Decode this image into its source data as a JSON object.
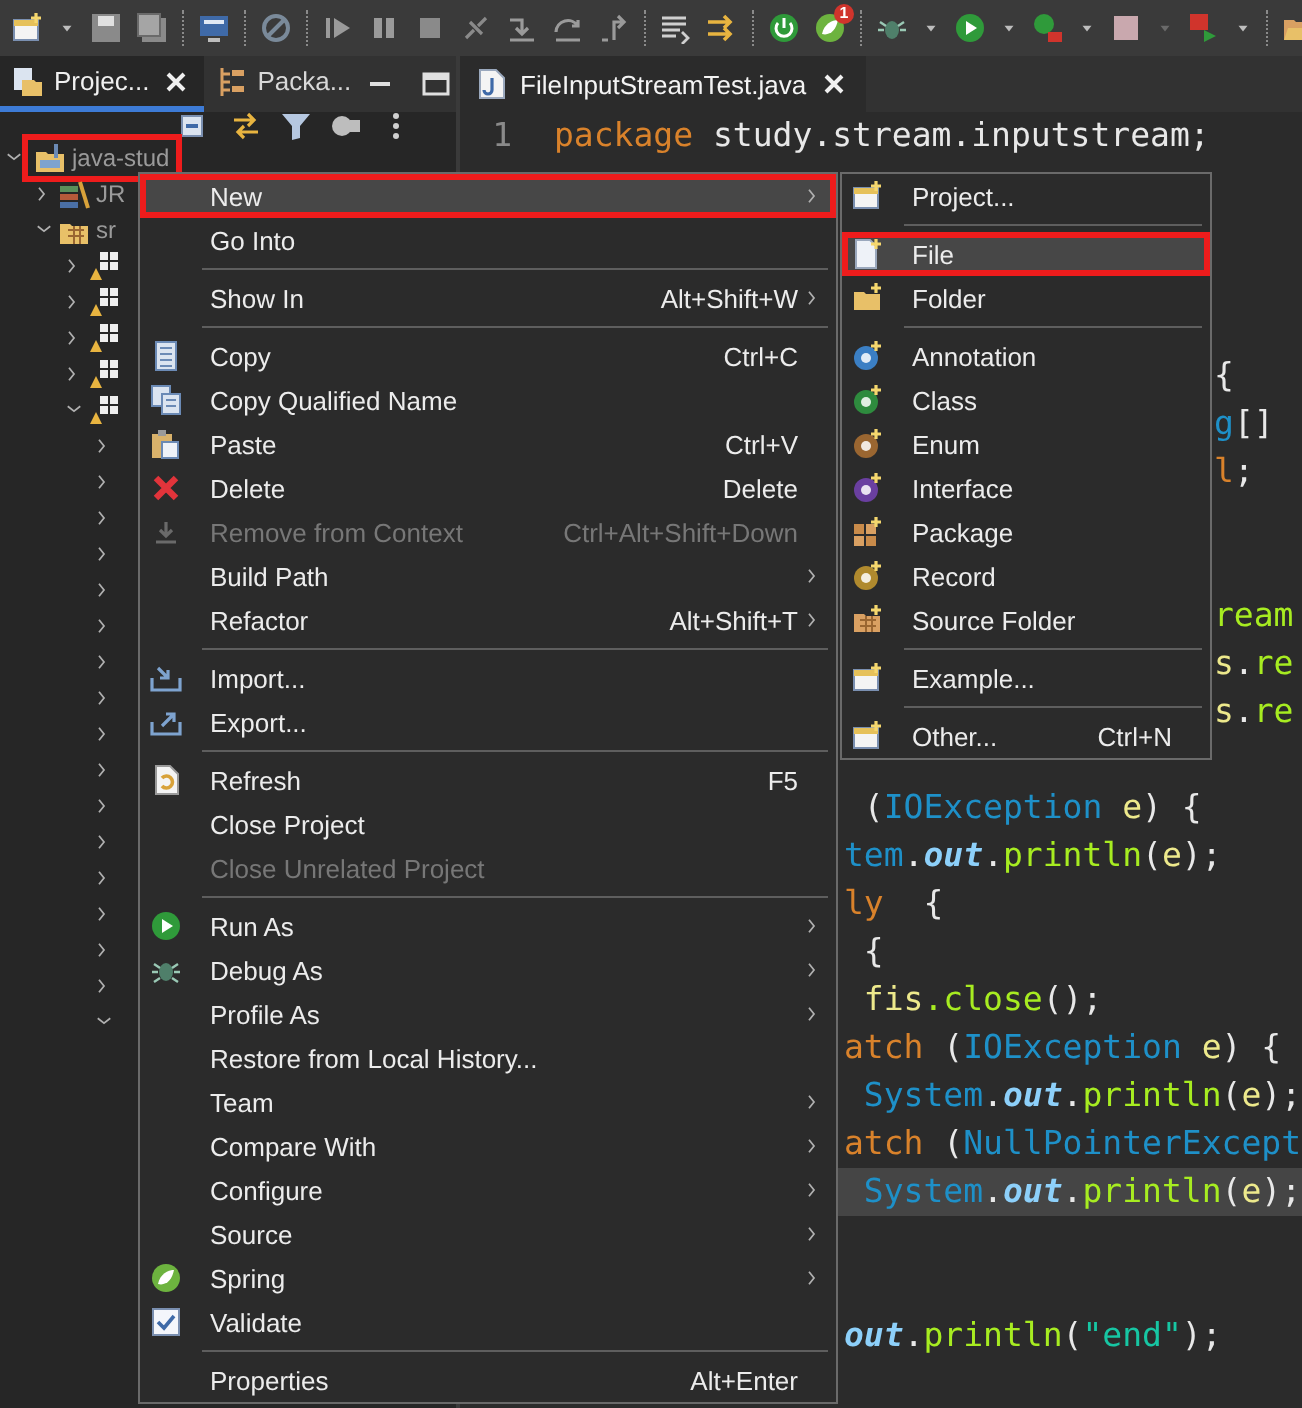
{
  "toolbar": {
    "badge": "1"
  },
  "left_panel": {
    "tabs": [
      {
        "label": "Projec...",
        "selected": true
      },
      {
        "label": "Packa...",
        "selected": false
      }
    ]
  },
  "tree": [
    {
      "label": "java-stud",
      "kind": "project",
      "expanded": true,
      "annotated": true,
      "children": [
        {
          "label": "JR",
          "kind": "library",
          "expanded": false,
          "annotated": false
        },
        {
          "label": "sr",
          "kind": "source-folder",
          "expanded": true,
          "annotated": false,
          "children": [
            {
              "kind": "package",
              "expanded": false,
              "annotated": false
            },
            {
              "kind": "package",
              "expanded": false,
              "annotated": false
            },
            {
              "kind": "package",
              "expanded": false,
              "annotated": false
            },
            {
              "kind": "package",
              "expanded": false,
              "annotated": false
            },
            {
              "kind": "package",
              "expanded": true,
              "annotated": false,
              "children": [
                {
                  "expanded": false
                },
                {
                  "expanded": false
                },
                {
                  "expanded": false
                },
                {
                  "expanded": false
                },
                {
                  "expanded": false
                },
                {
                  "expanded": false
                },
                {
                  "expanded": false
                },
                {
                  "expanded": false
                },
                {
                  "expanded": false
                },
                {
                  "expanded": false
                },
                {
                  "expanded": false
                },
                {
                  "expanded": false
                },
                {
                  "expanded": false
                },
                {
                  "expanded": false
                },
                {
                  "expanded": false
                },
                {
                  "expanded": false
                },
                {
                  "expanded": true
                }
              ]
            }
          ]
        }
      ]
    }
  ],
  "editor": {
    "tab": {
      "label": "FileInputStreamTest.java",
      "selected": true
    },
    "lines": [
      {
        "number": "1",
        "current": false,
        "tokens": [
          {
            "kind": "keyword",
            "text": "package"
          },
          {
            "kind": "plain",
            "text": " study.stream.inputstream;"
          }
        ]
      },
      {
        "current": false
      },
      {
        "current": false
      },
      {
        "current": false
      },
      {
        "current": false
      },
      {
        "current": false,
        "tokens": [
          {
            "kind": "plain",
            "text": "{"
          }
        ]
      },
      {
        "current": false,
        "tokens": [
          {
            "kind": "type",
            "text": "g"
          },
          {
            "kind": "plain",
            "text": "[]"
          }
        ]
      },
      {
        "current": false,
        "tokens": [
          {
            "kind": "keyword",
            "text": "l"
          },
          {
            "kind": "plain",
            "text": ";"
          }
        ]
      },
      {
        "current": false
      },
      {
        "current": false
      },
      {
        "current": false,
        "tokens": [
          {
            "kind": "method",
            "text": "ream"
          }
        ]
      },
      {
        "current": false,
        "tokens": [
          {
            "kind": "local",
            "text": "s"
          },
          {
            "kind": "plain",
            "text": "."
          },
          {
            "kind": "method",
            "text": "re"
          }
        ]
      },
      {
        "current": false,
        "tokens": [
          {
            "kind": "local",
            "text": "s"
          },
          {
            "kind": "plain",
            "text": "."
          },
          {
            "kind": "method",
            "text": "re"
          }
        ]
      },
      {
        "current": false
      },
      {
        "current": false,
        "tokens": [
          {
            "kind": "plain",
            "text": " ("
          },
          {
            "kind": "type",
            "text": "IOException "
          },
          {
            "kind": "local",
            "text": "e"
          },
          {
            "kind": "plain",
            "text": ") {"
          }
        ]
      },
      {
        "current": false,
        "tokens": [
          {
            "kind": "type",
            "text": "tem"
          },
          {
            "kind": "plain",
            "text": "."
          },
          {
            "kind": "field",
            "text": "out"
          },
          {
            "kind": "plain",
            "text": "."
          },
          {
            "kind": "method",
            "text": "println"
          },
          {
            "kind": "plain",
            "text": "("
          },
          {
            "kind": "local",
            "text": "e"
          },
          {
            "kind": "plain",
            "text": ");"
          }
        ]
      },
      {
        "current": false,
        "tokens": [
          {
            "kind": "keyword",
            "text": "ly"
          },
          {
            "kind": "plain",
            "text": "  {"
          }
        ]
      },
      {
        "current": false,
        "tokens": [
          {
            "kind": "plain",
            "text": " {"
          }
        ]
      },
      {
        "current": false,
        "tokens": [
          {
            "kind": "local",
            "text": " fis"
          },
          {
            "kind": "method",
            "text": ".close"
          },
          {
            "kind": "plain",
            "text": "();"
          }
        ]
      },
      {
        "current": false,
        "tokens": [
          {
            "kind": "keyword",
            "text": "atch"
          },
          {
            "kind": "plain",
            "text": " ("
          },
          {
            "kind": "type",
            "text": "IOException "
          },
          {
            "kind": "local",
            "text": "e"
          },
          {
            "kind": "plain",
            "text": ") {"
          }
        ]
      },
      {
        "current": false,
        "tokens": [
          {
            "kind": "type",
            "text": " System"
          },
          {
            "kind": "plain",
            "text": "."
          },
          {
            "kind": "field",
            "text": "out"
          },
          {
            "kind": "plain",
            "text": "."
          },
          {
            "kind": "method",
            "text": "println"
          },
          {
            "kind": "plain",
            "text": "("
          },
          {
            "kind": "local",
            "text": "e"
          },
          {
            "kind": "plain",
            "text": ");"
          }
        ]
      },
      {
        "current": false,
        "tokens": [
          {
            "kind": "keyword",
            "text": "atch"
          },
          {
            "kind": "plain",
            "text": " ("
          },
          {
            "kind": "type",
            "text": "NullPointerExcept"
          }
        ]
      },
      {
        "current": true,
        "tokens": [
          {
            "kind": "type",
            "text": " System"
          },
          {
            "kind": "plain",
            "text": "."
          },
          {
            "kind": "field",
            "text": "out"
          },
          {
            "kind": "plain",
            "text": "."
          },
          {
            "kind": "method",
            "text": "println"
          },
          {
            "kind": "plain",
            "text": "("
          },
          {
            "kind": "local",
            "text": "e"
          },
          {
            "kind": "plain",
            "text": ");"
          }
        ]
      },
      {
        "current": false
      },
      {
        "current": false
      },
      {
        "current": false,
        "tokens": [
          {
            "kind": "field",
            "text": "out"
          },
          {
            "kind": "plain",
            "text": "."
          },
          {
            "kind": "method",
            "text": "println"
          },
          {
            "kind": "plain",
            "text": "("
          },
          {
            "kind": "string",
            "text": "\"end\""
          },
          {
            "kind": "plain",
            "text": ");"
          }
        ]
      }
    ]
  },
  "context_menu": [
    {
      "kind": "item",
      "label": "New",
      "submenu": true,
      "selected": true,
      "disabled": false,
      "annotated": true
    },
    {
      "kind": "item",
      "label": "Go Into",
      "submenu": false,
      "selected": false,
      "disabled": false,
      "annotated": false
    },
    {
      "kind": "separator"
    },
    {
      "kind": "item",
      "label": "Show In",
      "shortcut": "Alt+Shift+W",
      "submenu": true,
      "selected": false,
      "disabled": false,
      "annotated": false
    },
    {
      "kind": "separator"
    },
    {
      "kind": "item",
      "label": "Copy",
      "shortcut": "Ctrl+C",
      "submenu": false,
      "selected": false,
      "disabled": false,
      "annotated": false
    },
    {
      "kind": "item",
      "label": "Copy Qualified Name",
      "submenu": false,
      "selected": false,
      "disabled": false,
      "annotated": false
    },
    {
      "kind": "item",
      "label": "Paste",
      "shortcut": "Ctrl+V",
      "submenu": false,
      "selected": false,
      "disabled": false,
      "annotated": false
    },
    {
      "kind": "item",
      "label": "Delete",
      "shortcut": "Delete",
      "submenu": false,
      "selected": false,
      "disabled": false,
      "annotated": false
    },
    {
      "kind": "item",
      "label": "Remove from Context",
      "shortcut": "Ctrl+Alt+Shift+Down",
      "submenu": false,
      "selected": false,
      "disabled": true,
      "annotated": false
    },
    {
      "kind": "item",
      "label": "Build Path",
      "submenu": true,
      "selected": false,
      "disabled": false,
      "annotated": false
    },
    {
      "kind": "item",
      "label": "Refactor",
      "shortcut": "Alt+Shift+T",
      "submenu": true,
      "selected": false,
      "disabled": false,
      "annotated": false
    },
    {
      "kind": "separator"
    },
    {
      "kind": "item",
      "label": "Import...",
      "submenu": false,
      "selected": false,
      "disabled": false,
      "annotated": false
    },
    {
      "kind": "item",
      "label": "Export...",
      "submenu": false,
      "selected": false,
      "disabled": false,
      "annotated": false
    },
    {
      "kind": "separator"
    },
    {
      "kind": "item",
      "label": "Refresh",
      "shortcut": "F5",
      "submenu": false,
      "selected": false,
      "disabled": false,
      "annotated": false
    },
    {
      "kind": "item",
      "label": "Close Project",
      "submenu": false,
      "selected": false,
      "disabled": false,
      "annotated": false
    },
    {
      "kind": "item",
      "label": "Close Unrelated Project",
      "submenu": false,
      "selected": false,
      "disabled": true,
      "annotated": false
    },
    {
      "kind": "separator"
    },
    {
      "kind": "item",
      "label": "Run As",
      "submenu": true,
      "selected": false,
      "disabled": false,
      "annotated": false
    },
    {
      "kind": "item",
      "label": "Debug As",
      "submenu": true,
      "selected": false,
      "disabled": false,
      "annotated": false
    },
    {
      "kind": "item",
      "label": "Profile As",
      "submenu": true,
      "selected": false,
      "disabled": false,
      "annotated": false
    },
    {
      "kind": "item",
      "label": "Restore from Local History...",
      "submenu": false,
      "selected": false,
      "disabled": false,
      "annotated": false
    },
    {
      "kind": "item",
      "label": "Team",
      "submenu": true,
      "selected": false,
      "disabled": false,
      "annotated": false
    },
    {
      "kind": "item",
      "label": "Compare With",
      "submenu": true,
      "selected": false,
      "disabled": false,
      "annotated": false
    },
    {
      "kind": "item",
      "label": "Configure",
      "submenu": true,
      "selected": false,
      "disabled": false,
      "annotated": false
    },
    {
      "kind": "item",
      "label": "Source",
      "submenu": true,
      "selected": false,
      "disabled": false,
      "annotated": false
    },
    {
      "kind": "item",
      "label": "Spring",
      "submenu": true,
      "selected": false,
      "disabled": false,
      "annotated": false
    },
    {
      "kind": "item",
      "label": "Validate",
      "submenu": false,
      "selected": false,
      "disabled": false,
      "annotated": false
    },
    {
      "kind": "separator"
    },
    {
      "kind": "item",
      "label": "Properties",
      "shortcut": "Alt+Enter",
      "submenu": false,
      "selected": false,
      "disabled": false,
      "annotated": false
    }
  ],
  "submenu": [
    {
      "kind": "item",
      "label": "Project...",
      "submenu": false,
      "selected": false,
      "disabled": false,
      "annotated": false
    },
    {
      "kind": "separator"
    },
    {
      "kind": "item",
      "label": "File",
      "submenu": false,
      "selected": true,
      "disabled": false,
      "annotated": true
    },
    {
      "kind": "item",
      "label": "Folder",
      "submenu": false,
      "selected": false,
      "disabled": false,
      "annotated": false
    },
    {
      "kind": "separator"
    },
    {
      "kind": "item",
      "label": "Annotation",
      "submenu": false,
      "selected": false,
      "disabled": false,
      "annotated": false
    },
    {
      "kind": "item",
      "label": "Class",
      "submenu": false,
      "selected": false,
      "disabled": false,
      "annotated": false
    },
    {
      "kind": "item",
      "label": "Enum",
      "submenu": false,
      "selected": false,
      "disabled": false,
      "annotated": false
    },
    {
      "kind": "item",
      "label": "Interface",
      "submenu": false,
      "selected": false,
      "disabled": false,
      "annotated": false
    },
    {
      "kind": "item",
      "label": "Package",
      "submenu": false,
      "selected": false,
      "disabled": false,
      "annotated": false
    },
    {
      "kind": "item",
      "label": "Record",
      "submenu": false,
      "selected": false,
      "disabled": false,
      "annotated": false
    },
    {
      "kind": "item",
      "label": "Source Folder",
      "submenu": false,
      "selected": false,
      "disabled": false,
      "annotated": false
    },
    {
      "kind": "separator"
    },
    {
      "kind": "item",
      "label": "Example...",
      "submenu": false,
      "selected": false,
      "disabled": false,
      "annotated": false
    },
    {
      "kind": "separator"
    },
    {
      "kind": "item",
      "label": "Other...",
      "shortcut": "Ctrl+N",
      "submenu": false,
      "selected": false,
      "disabled": false,
      "annotated": false
    }
  ]
}
